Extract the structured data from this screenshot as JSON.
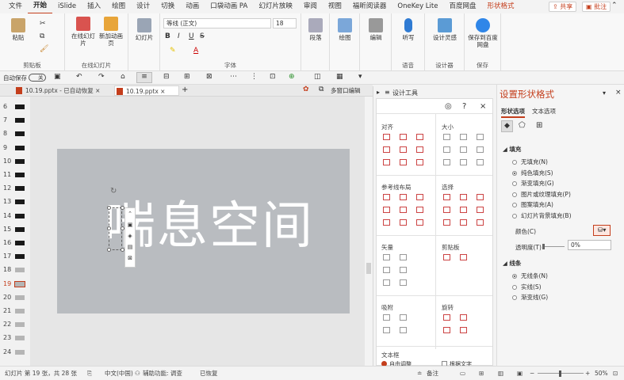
{
  "tabs": [
    "文件",
    "开始",
    "iSlide",
    "插入",
    "绘图",
    "设计",
    "切换",
    "动画",
    "口袋动画 PA",
    "幻灯片放映",
    "审阅",
    "视图",
    "福昕阅读器",
    "OneKey Lite",
    "百度网盘",
    "形状格式"
  ],
  "share_label": "共享",
  "comment_label": "批注",
  "ribbon": {
    "clipboard": {
      "label": "剪贴板",
      "paste": "粘贴"
    },
    "online_slides": {
      "label": "在线幻灯片",
      "btn1": "在线幻灯片",
      "btn2": "新加动画页"
    },
    "slides": {
      "btn": "幻灯片"
    },
    "font": {
      "label": "字体",
      "name": "等线 (正文)",
      "size": "18"
    },
    "paragraph": "段落",
    "drawing": "绘图",
    "editing": "编辑",
    "voice": {
      "label": "语音",
      "btn": "听写"
    },
    "designer": {
      "label": "设计器",
      "btn": "设计灵感"
    },
    "save": {
      "label": "保存",
      "btn": "保存到百度网盘"
    }
  },
  "qat": {
    "autosave": "自动保存",
    "toggle": "关"
  },
  "doc_tabs": [
    {
      "name": "10.19.pptx",
      "status": "- 已自动恢复"
    },
    {
      "name": "10.19.pptx"
    }
  ],
  "multiwin": "多窗口编辑",
  "slide_numbers": [
    "6",
    "7",
    "8",
    "9",
    "10",
    "11",
    "12",
    "13",
    "14",
    "15",
    "16",
    "17",
    "18",
    "19",
    "20",
    "21",
    "22",
    "23",
    "24"
  ],
  "current_slide": "19",
  "slide_text": "喘息空间",
  "design_tools": {
    "title": "设计工具",
    "sections": {
      "align": "对齐",
      "size": "大小",
      "guides": "参考线布局",
      "select": "选择",
      "vector": "矢量",
      "clipboard": "剪贴板",
      "snap": "吸附",
      "rotate": "旋转",
      "textbox": "文本框"
    },
    "autofit": "自由调整",
    "fit_text": "根据文字"
  },
  "format_pane": {
    "title": "设置形状格式",
    "tab_shape": "形状选项",
    "tab_text": "文本选项",
    "fill_header": "填充",
    "fill_options": [
      "无填充(N)",
      "纯色填充(S)",
      "渐变填充(G)",
      "图片或纹理填充(P)",
      "图案填充(A)",
      "幻灯片背景填充(B)"
    ],
    "color_label": "颜色(C)",
    "transparency_label": "透明度(T)",
    "transparency_value": "0%",
    "line_header": "线条",
    "line_options": [
      "无线条(N)",
      "实线(S)",
      "渐变线(G)"
    ]
  },
  "status": {
    "slide": "幻灯片 第 19 张，共 28 张",
    "lang": "中文(中国)",
    "access": "辅助功能: 调查",
    "recovered": "已恢复",
    "notes": "备注",
    "zoom": "50%"
  }
}
